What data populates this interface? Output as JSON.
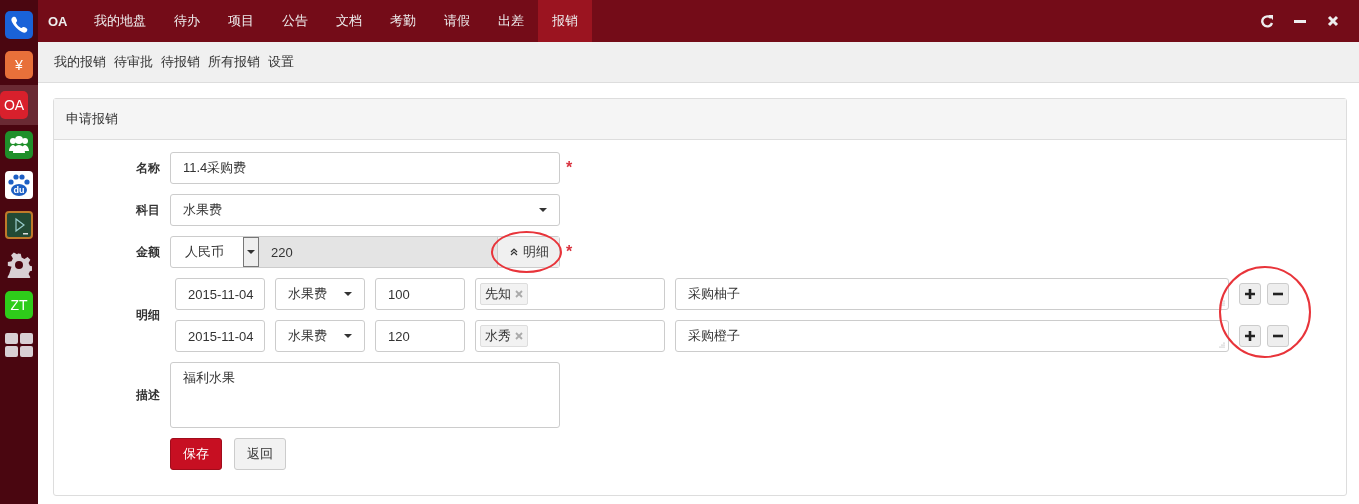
{
  "dock": [
    {
      "kind": "phone",
      "selected": false
    },
    {
      "kind": "text",
      "text": "¥",
      "color": "#e8703a",
      "selected": false
    },
    {
      "kind": "text",
      "text": "OA",
      "color": "#d8202c",
      "selected": true
    },
    {
      "kind": "people",
      "selected": false
    },
    {
      "kind": "paw",
      "text": "du",
      "selected": false
    },
    {
      "kind": "board",
      "selected": false
    },
    {
      "kind": "gear",
      "selected": false
    },
    {
      "kind": "text",
      "text": "ZT",
      "color": "#2ecc1a",
      "selected": false
    },
    {
      "kind": "grid",
      "selected": false
    }
  ],
  "topbar": {
    "brand": "OA",
    "tabs": [
      {
        "label": "我的地盘",
        "selected": false
      },
      {
        "label": "待办",
        "selected": false
      },
      {
        "label": "项目",
        "selected": false
      },
      {
        "label": "公告",
        "selected": false
      },
      {
        "label": "文档",
        "selected": false
      },
      {
        "label": "考勤",
        "selected": false
      },
      {
        "label": "请假",
        "selected": false
      },
      {
        "label": "出差",
        "selected": false
      },
      {
        "label": "报销",
        "selected": true
      }
    ]
  },
  "subnav": [
    {
      "label": "我的报销"
    },
    {
      "label": "待审批"
    },
    {
      "label": "待报销"
    },
    {
      "label": "所有报销"
    },
    {
      "label": "设置"
    }
  ],
  "panel": {
    "title": "申请报销",
    "name": {
      "label": "名称",
      "value": "11.4采购费",
      "required_mark": "*"
    },
    "subject": {
      "label": "科目",
      "value": "水果费"
    },
    "amount": {
      "label": "金额",
      "currency": "人民币",
      "value": "220",
      "detail_button": "明细",
      "circled": true,
      "required_mark": "*"
    },
    "details": {
      "label": "明细",
      "actions_circled": true,
      "rows": [
        {
          "date": "2015-11-04",
          "subject": "水果费",
          "amount": "100",
          "people": [
            "先知"
          ],
          "note": "采购柚子"
        },
        {
          "date": "2015-11-04",
          "subject": "水果费",
          "amount": "120",
          "people": [
            "水秀"
          ],
          "note": "采购橙子"
        }
      ]
    },
    "description": {
      "label": "描述",
      "value": "福利水果"
    },
    "buttons": [
      {
        "kind": "primary",
        "label": "保存"
      },
      {
        "kind": "default",
        "label": "返回"
      }
    ]
  }
}
